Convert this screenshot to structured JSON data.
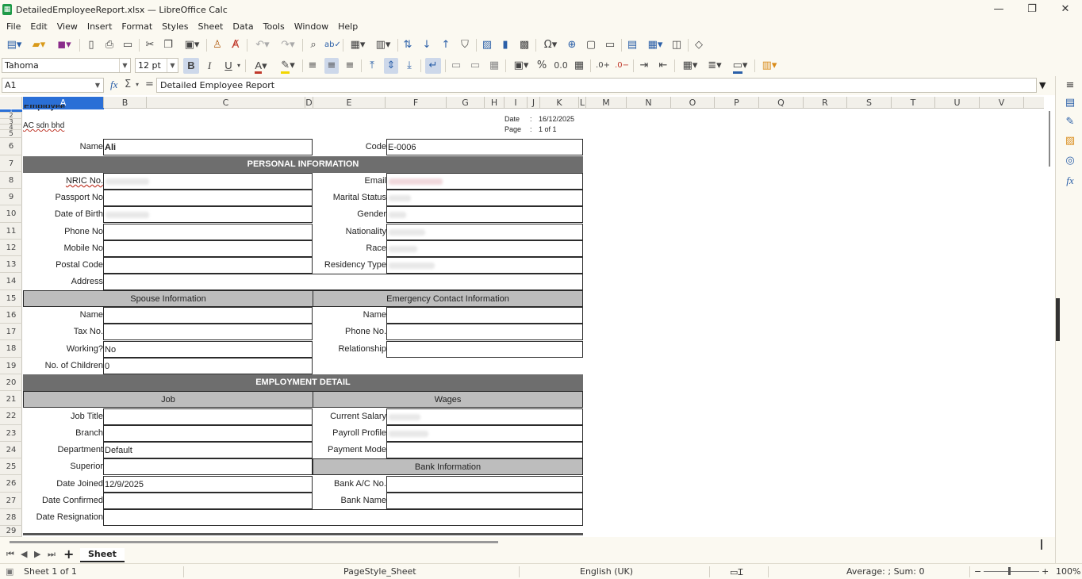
{
  "window": {
    "app_icon": "calc-icon",
    "title": "DetailedEmployeeReport.xlsx — LibreOffice Calc",
    "minimize": "—",
    "maximize": "❐",
    "close": "✕"
  },
  "menu": [
    "File",
    "Edit",
    "View",
    "Insert",
    "Format",
    "Styles",
    "Sheet",
    "Data",
    "Tools",
    "Window",
    "Help"
  ],
  "toolbar2": {
    "font_name": "Tahoma",
    "font_size": "12 pt",
    "bold": "B",
    "italic": "I",
    "underline": "U",
    "percent": "%",
    "number_format": "0.0"
  },
  "formula_bar": {
    "cell_ref": "A1",
    "fx": "fx",
    "sigma": "Σ",
    "equals": "=",
    "content": "Detailed Employee Report"
  },
  "columns": [
    "A",
    "B",
    "C",
    "D",
    "E",
    "F",
    "G",
    "H",
    "I",
    "J",
    "K",
    "L",
    "M",
    "N",
    "O",
    "P",
    "Q",
    "R",
    "S",
    "T",
    "U",
    "V"
  ],
  "rows": [
    "1",
    "2",
    "3",
    "4",
    "5",
    "6",
    "7",
    "8",
    "9",
    "10",
    "11",
    "12",
    "13",
    "14",
    "15",
    "16",
    "17",
    "18",
    "19",
    "20",
    "21",
    "22",
    "23",
    "24",
    "25",
    "26",
    "27",
    "28",
    "29"
  ],
  "report": {
    "top_title_fragment": "Employee",
    "company": "AC sdn bhd",
    "date_label": "Date",
    "date_value": "16/12/2025",
    "page_label": "Page",
    "page_value": "1 of 1",
    "colon": ":",
    "name_label": "Name",
    "name_value": "Ali",
    "code_label": "Code",
    "code_value": "E-0006",
    "personal_header": "PERSONAL INFORMATION",
    "personal_left": [
      "NRIC No.",
      "Passport No",
      "Date of Birth",
      "Phone No",
      "Mobile No",
      "Postal Code"
    ],
    "personal_right": [
      "Email",
      "Marital Status",
      "Gender",
      "Nationality",
      "Race",
      "Residency Type"
    ],
    "address_label": "Address",
    "spouse_header": "Spouse Information",
    "emergency_header": "Emergency Contact Information",
    "spouse_labels": [
      "Name",
      "Tax No.",
      "Working?",
      "No. of Children"
    ],
    "spouse_values": [
      "",
      "",
      "No",
      "0"
    ],
    "emergency_labels": [
      "Name",
      "Phone No.",
      "Relationship"
    ],
    "employment_header": "EMPLOYMENT DETAIL",
    "job_header": "Job",
    "wages_header": "Wages",
    "job_labels": [
      "Job Title",
      "Branch",
      "Department",
      "Superior",
      "Date Joined",
      "Date Confirmed",
      "Date Resignation"
    ],
    "job_values": [
      "",
      "",
      "Default",
      "",
      "12/9/2025",
      "",
      ""
    ],
    "wages_labels": [
      "Current Salary",
      "Payroll Profile",
      "Payment Mode"
    ],
    "bank_header": "Bank Information",
    "bank_labels": [
      "Bank A/C No.",
      "Bank Name"
    ]
  },
  "sheet_tabs": {
    "add": "+",
    "active": "Sheet"
  },
  "status": {
    "sheet_pos": "Sheet 1 of 1",
    "page_style": "PageStyle_Sheet",
    "language": "English (UK)",
    "summary": "Average: ; Sum: 0",
    "zoom_minus": "−",
    "zoom_plus": "+",
    "zoom": "100%"
  }
}
